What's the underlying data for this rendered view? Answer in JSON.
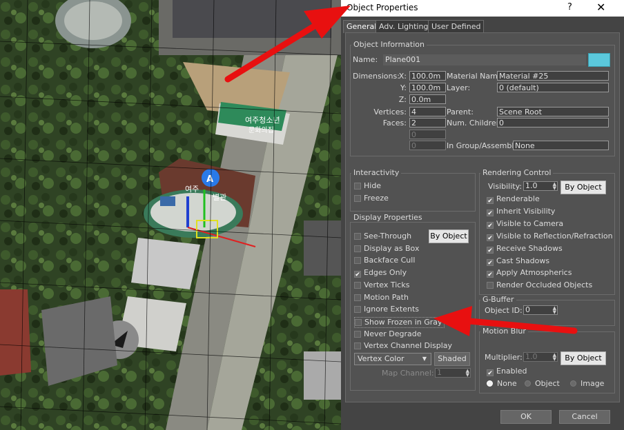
{
  "viewport": {
    "signs": [
      "여주청소년",
      "문화의집",
      "여주",
      "별관"
    ],
    "gizmo_label": "A"
  },
  "dialog": {
    "title": "Object Properties",
    "help": "?",
    "close": "✕",
    "tabs": [
      "General",
      "Adv. Lighting",
      "User Defined"
    ]
  },
  "object_info": {
    "title": "Object Information",
    "name_label": "Name:",
    "name": "Plane001",
    "color": "#5bc8dc",
    "dimensions_label": "Dimensions:",
    "x_label": "X:",
    "x": "100.0m",
    "y_label": "Y:",
    "y": "100.0m",
    "z_label": "Z:",
    "z": "0.0m",
    "vertices_label": "Vertices:",
    "vertices": "4",
    "faces_label": "Faces:",
    "faces": "2",
    "blank1": "0",
    "blank2": "0",
    "material_label": "Material Name:",
    "material": "Material #25",
    "layer_label": "Layer:",
    "layer": "0 (default)",
    "parent_label": "Parent:",
    "parent": "Scene Root",
    "children_label": "Num. Children:",
    "children": "0",
    "group_label": "In Group/Assembly:",
    "group": "None"
  },
  "interactivity": {
    "title": "Interactivity",
    "hide": "Hide",
    "freeze": "Freeze"
  },
  "display": {
    "title": "Display Properties",
    "by_object": "By Object",
    "items": [
      "See-Through",
      "Display as Box",
      "Backface Cull",
      "Edges Only",
      "Vertex Ticks",
      "Motion Path",
      "Ignore Extents",
      "Show Frozen in Gray",
      "Never Degrade",
      "Vertex Channel Display"
    ],
    "checked": [
      false,
      false,
      false,
      true,
      false,
      false,
      false,
      false,
      false,
      false
    ],
    "vertex_color": "Vertex Color",
    "shaded": "Shaded",
    "map_channel_label": "Map Channel:",
    "map_channel": "1"
  },
  "rendering": {
    "title": "Rendering Control",
    "visibility_label": "Visibility:",
    "visibility": "1.0",
    "by_object": "By Object",
    "items": [
      "Renderable",
      "Inherit Visibility",
      "Visible to Camera",
      "Visible to Reflection/Refraction",
      "Receive Shadows",
      "Cast Shadows",
      "Apply Atmospherics",
      "Render Occluded Objects"
    ],
    "checked": [
      true,
      true,
      true,
      true,
      true,
      true,
      true,
      false
    ]
  },
  "gbuffer": {
    "title": "G-Buffer",
    "id_label": "Object ID:",
    "id": "0"
  },
  "motion_blur": {
    "title": "Motion Blur",
    "multiplier_label": "Multiplier:",
    "multiplier": "1.0",
    "by_object": "By Object",
    "enabled": "Enabled",
    "none": "None",
    "object": "Object",
    "image": "Image"
  },
  "footer": {
    "ok": "OK",
    "cancel": "Cancel"
  }
}
